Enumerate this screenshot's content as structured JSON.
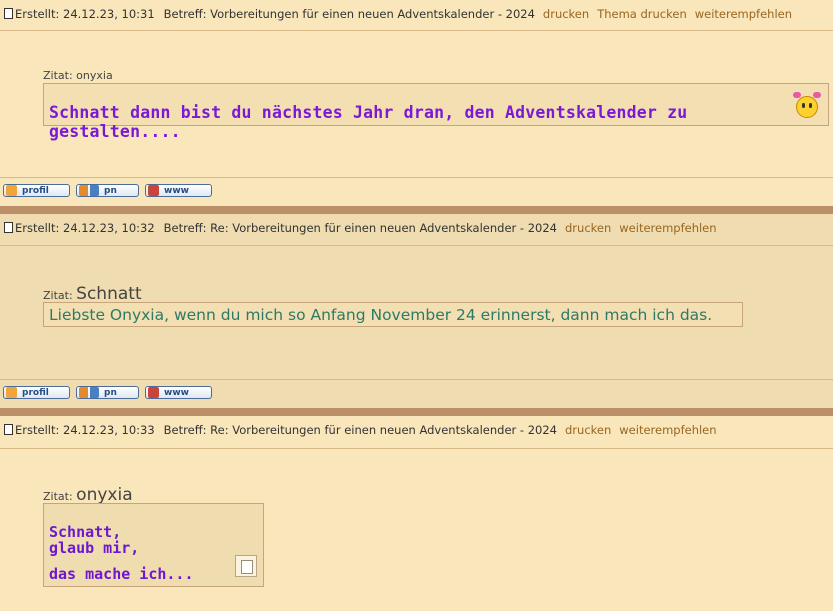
{
  "posts": [
    {
      "created": "Erstellt: 24.12.23, 10:31",
      "subject": "Betreff: Vorbereitungen für einen neuen Adventskalender - 2024",
      "links": [
        "drucken",
        "Thema drucken",
        "weiterempfehlen"
      ],
      "quote_label": "Zitat:",
      "quote_author": "onyxia",
      "quote_text": "Schnatt dann bist du nächstes Jahr dran, den Adventskalender zu gestalten...."
    },
    {
      "created": "Erstellt: 24.12.23, 10:32",
      "subject": "Betreff: Re: Vorbereitungen für einen neuen Adventskalender - 2024",
      "links": [
        "drucken",
        "weiterempfehlen"
      ],
      "quote_label": "Zitat:",
      "quote_author": "Schnatt",
      "quote_text": "Liebste Onyxia, wenn du mich so Anfang November 24 erinnerst, dann mach ich das."
    },
    {
      "created": "Erstellt: 24.12.23, 10:33",
      "subject": "Betreff: Re: Vorbereitungen für einen neuen Adventskalender - 2024",
      "links": [
        "drucken",
        "weiterempfehlen"
      ],
      "quote_label": "Zitat:",
      "quote_author": "onyxia",
      "quote_lines": [
        "Schnatt,",
        "glaub mir,",
        "das mache ich..."
      ]
    }
  ],
  "buttons": {
    "profil": "profil",
    "pn": "pn",
    "www": "www"
  },
  "colors": {
    "background": "#f9e6bb",
    "separator": "#bb8f68",
    "link": "#99661f",
    "quote_purple": "#7a19d6",
    "quote_green": "#2d7a67"
  }
}
